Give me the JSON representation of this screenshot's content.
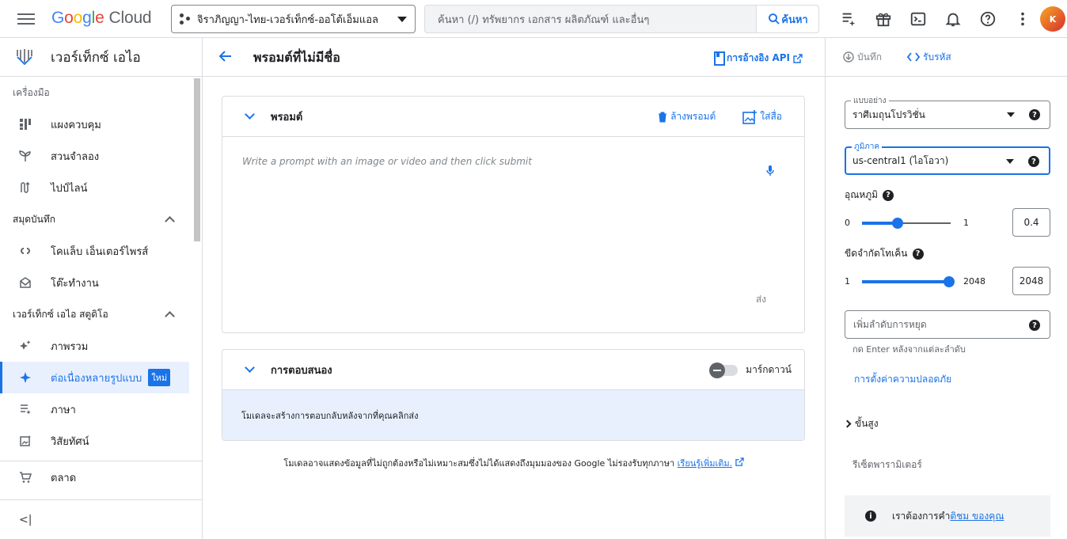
{
  "topbar": {
    "logo_google": [
      "G",
      "o",
      "o",
      "g",
      "l",
      "e"
    ],
    "logo_cloud": "Cloud",
    "project": "จิราภิญญา-ไทย-เวอร์เท็กซ์-ออโต้เอ็มแอล",
    "search_placeholder": "ค้นหา (/) ทรัพยากร เอกสาร ผลิตภัณฑ์ และอื่นๆ",
    "search_button": "ค้นหา",
    "avatar_initials": "K"
  },
  "sidebar": {
    "title": "เวอร์เท็กซ์ เอไอ",
    "tools_label": "เครื่องมือ",
    "tools": [
      {
        "label": "แผงควบคุม",
        "icon": "dashboard-icon"
      },
      {
        "label": "สวนจำลอง",
        "icon": "model-garden-icon"
      },
      {
        "label": "ไปป์ไลน์",
        "icon": "pipelines-icon"
      }
    ],
    "notebooks_label": "สมุดบันทึก",
    "notebooks": [
      {
        "label": "โคแล็บ เอ็นเตอร์ไพรส์",
        "icon": "colab-icon"
      },
      {
        "label": "โต๊ะทำงาน",
        "icon": "workbench-icon"
      }
    ],
    "studio_label": "เวอร์เท็กซ์ เอไอ สตูดิโอ",
    "studio": [
      {
        "label": "ภาพรวม",
        "icon": "overview-icon"
      },
      {
        "label": "ต่อเนื่องหลายรูปแบบ",
        "icon": "sparkle-icon",
        "badge": "ใหม่"
      },
      {
        "label": "ภาษา",
        "icon": "language-icon"
      },
      {
        "label": "วิสัยทัศน์",
        "icon": "vision-icon"
      }
    ],
    "marketplace": "ตลาด",
    "collapse": "<|"
  },
  "main": {
    "title": "พรอมต์ที่ไม่มีชื่อ",
    "api_ref": "การอ้างอิง API",
    "prompt_card": {
      "title": "พรอมต์",
      "clear": "ล้างพรอมต์",
      "insert_media": "ใส่สื่อ",
      "placeholder": "Write a prompt with an image or video and then click submit",
      "send": "ส่ง"
    },
    "response_card": {
      "title": "การตอบสนอง",
      "markdown": "มาร์กดาวน์",
      "body": "โมเดลจะสร้างการตอบกลับหลังจากที่คุณคลิกส่ง"
    },
    "disclaimer": "โมเดลอาจแสดงข้อมูลที่ไม่ถูกต้องหรือไม่เหมาะสมซึ่งไม่ได้แสดงถึงมุมมองของ Google ไม่รองรับทุกภาษา",
    "learn_more": "เรียนรู้เพิ่มเติม."
  },
  "right": {
    "save": "บันทึก",
    "get_code": "รับรหัส",
    "model_label": "แบบอย่าง",
    "model_value": "ราศีเมถุนโปรวิชั่น",
    "region_label": "ภูมิภาค",
    "region_value": "us-central1 (ไอโอวา)",
    "temperature_label": "อุณหภูมิ",
    "temperature_min": "0",
    "temperature_max": "1",
    "temperature_value": "0.4",
    "temperature_fraction": 0.4,
    "token_label": "ขีดจำกัดโทเค็น",
    "token_min": "1",
    "token_max": "2048",
    "token_value": "2048",
    "token_fraction": 1.0,
    "stop_placeholder": "เพิ่มลำดับการหยุด",
    "stop_hint": "กด Enter หลังจากแต่ละลำดับ",
    "safety": "การตั้งค่าความปลอดภัย",
    "advanced": "ขั้นสูง",
    "reset": "รีเซ็ตพารามิเตอร์",
    "feedback_text": "เราต้องการคำ",
    "feedback_link": "ติชม ของคุณ"
  },
  "colors": {
    "accent": "#1a73e8",
    "active_bg": "#e8f0fe",
    "border": "#dadce0"
  }
}
